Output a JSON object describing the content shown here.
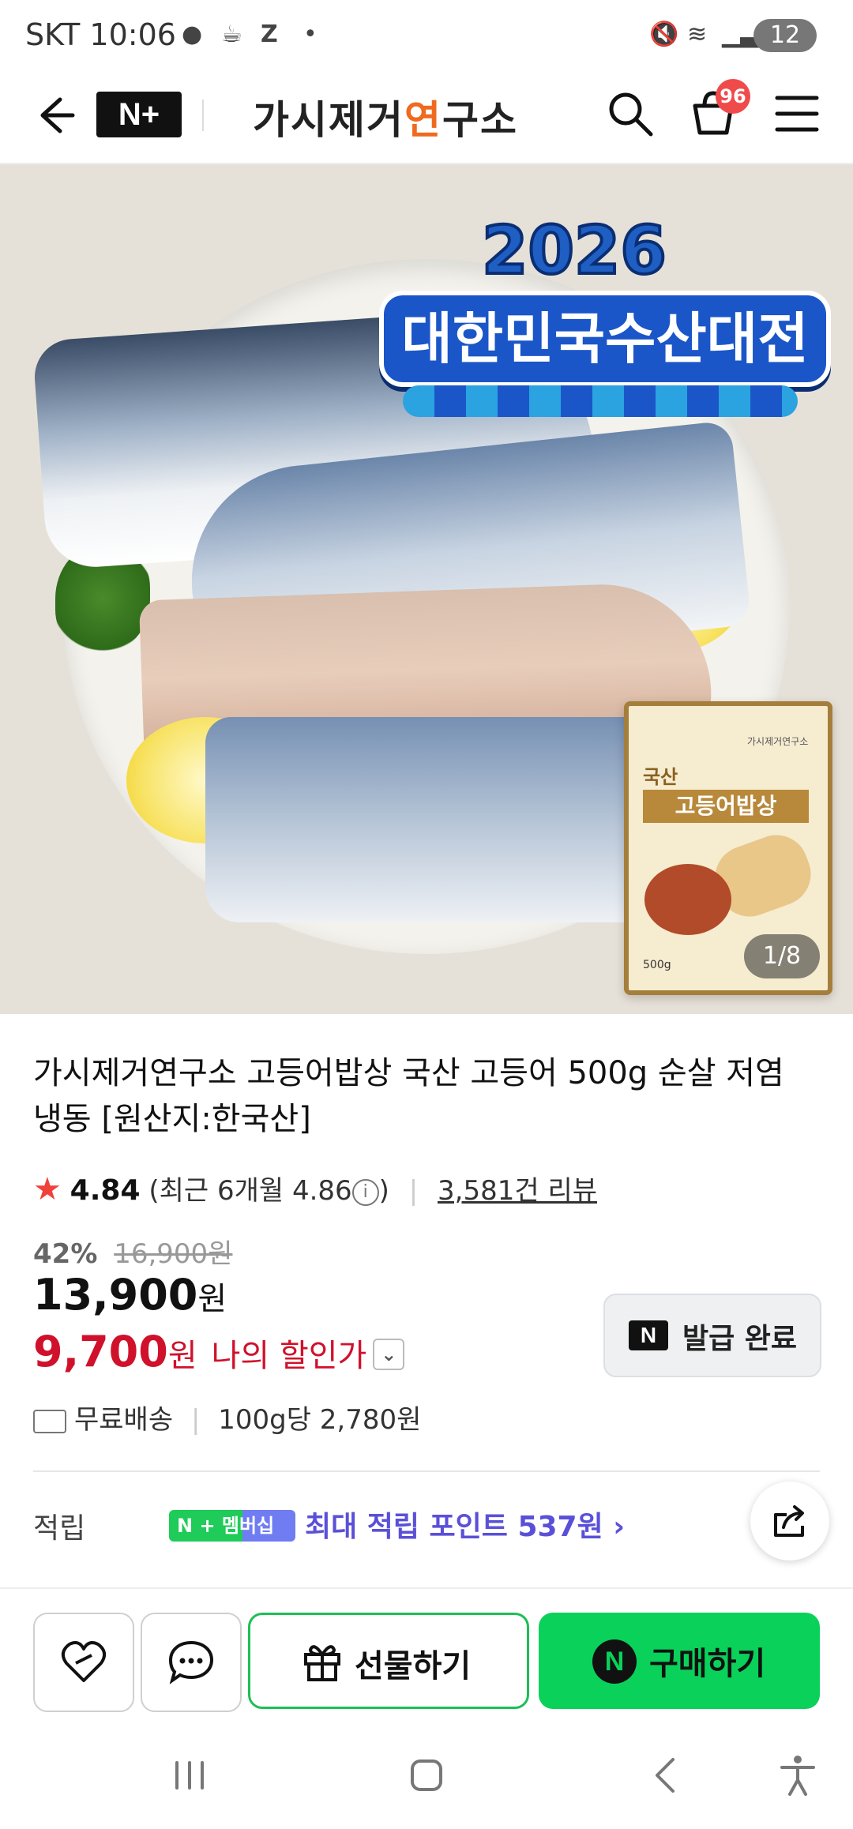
{
  "status_bar": {
    "carrier": "SKT",
    "time": "10:06",
    "app_letter": "Z",
    "battery": "12"
  },
  "header": {
    "nplus_label": "N+",
    "brand": [
      "가시제거",
      "연",
      "구소"
    ],
    "cart_badge": "96"
  },
  "hero": {
    "banner_year": "2026",
    "banner_title": "대한민국수산대전",
    "pack_brand": "가시제거연구소",
    "pack_origin": "국산",
    "pack_name": "고등어밥상",
    "pack_weight": "500g",
    "counter": "1/8"
  },
  "product": {
    "title": "가시제거연구소 고등어밥상 국산 고등어 500g 순살 저염 냉동 [원산지:한국산]",
    "rating": "4.84",
    "recent_rating": "(최근 6개월 4.86",
    "recent_close": ")",
    "reviews": "3,581건 리뷰",
    "discount_pct": "42%",
    "original_price": "16,900원",
    "price": "13,900",
    "price_won": "원",
    "my_price": "9,700",
    "my_price_won": "원",
    "my_price_label": "나의 할인가",
    "issue_button": "발급 완료",
    "shipping": "무료배송",
    "unit_price": "100g당 2,780원",
    "earn_label": "적립",
    "earn_pill": "N + 멤버십",
    "earn_text": "최대 적립 포인트 537원"
  },
  "bottom_bar": {
    "gift": "선물하기",
    "buy": "구매하기"
  },
  "colors": {
    "accent_green": "#09d15a",
    "discount_red": "#d0112b",
    "membership_purple": "#5a50d8",
    "badge_red": "#f04b4b"
  }
}
